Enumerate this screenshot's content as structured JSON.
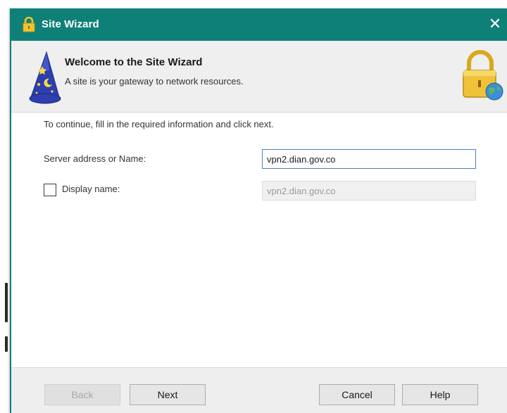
{
  "window": {
    "title": "Site Wizard",
    "close_glyph": "✕",
    "title_icon": "lock-icon",
    "accent_color": "#0f8078"
  },
  "header": {
    "title": "Welcome to the Site Wizard",
    "subtitle": "A site is your gateway to network resources.",
    "left_icon": "wizard-hat-icon",
    "right_icon": "lock-globe-icon"
  },
  "form": {
    "instructions": "To continue, fill in the required information and click next.",
    "server_label": "Server address or Name:",
    "server_value": "vpn2.dian.gov.co",
    "display_label": "Display name:",
    "display_checked": false,
    "display_value": "vpn2.dian.gov.co"
  },
  "buttons": {
    "back": "Back",
    "back_enabled": false,
    "next": "Next",
    "cancel": "Cancel",
    "help": "Help"
  }
}
